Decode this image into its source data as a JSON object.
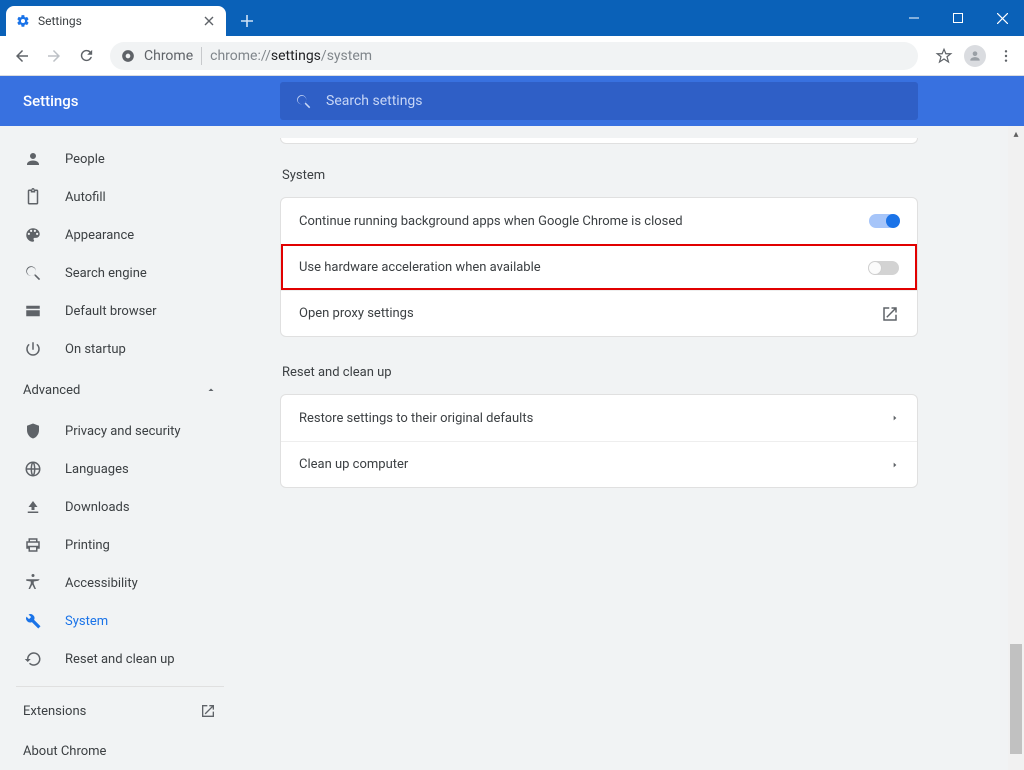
{
  "window": {
    "tab_title": "Settings",
    "tab_favicon": "gear-blue"
  },
  "omnibox": {
    "chrome_label": "Chrome",
    "url_prefix": "chrome://",
    "url_emph": "settings",
    "url_suffix": "/system"
  },
  "header": {
    "title": "Settings",
    "search_placeholder": "Search settings"
  },
  "sidebar": {
    "items": [
      {
        "icon": "person-icon",
        "label": "People"
      },
      {
        "icon": "clipboard-icon",
        "label": "Autofill"
      },
      {
        "icon": "palette-icon",
        "label": "Appearance"
      },
      {
        "icon": "search-icon",
        "label": "Search engine"
      },
      {
        "icon": "browser-icon",
        "label": "Default browser"
      },
      {
        "icon": "power-icon",
        "label": "On startup"
      }
    ],
    "advanced_label": "Advanced",
    "advanced": [
      {
        "icon": "shield-icon",
        "label": "Privacy and security"
      },
      {
        "icon": "globe-icon",
        "label": "Languages"
      },
      {
        "icon": "download-icon",
        "label": "Downloads"
      },
      {
        "icon": "printer-icon",
        "label": "Printing"
      },
      {
        "icon": "accessibility-icon",
        "label": "Accessibility"
      },
      {
        "icon": "wrench-icon",
        "label": "System",
        "active": true
      },
      {
        "icon": "restore-icon",
        "label": "Reset and clean up"
      }
    ],
    "extensions_label": "Extensions",
    "about_label": "About Chrome"
  },
  "main": {
    "system_title": "System",
    "bg_apps_label": "Continue running background apps when Google Chrome is closed",
    "bg_apps_on": true,
    "hw_accel_label": "Use hardware acceleration when available",
    "hw_accel_on": false,
    "proxy_label": "Open proxy settings",
    "reset_title": "Reset and clean up",
    "restore_label": "Restore settings to their original defaults",
    "cleanup_label": "Clean up computer"
  }
}
